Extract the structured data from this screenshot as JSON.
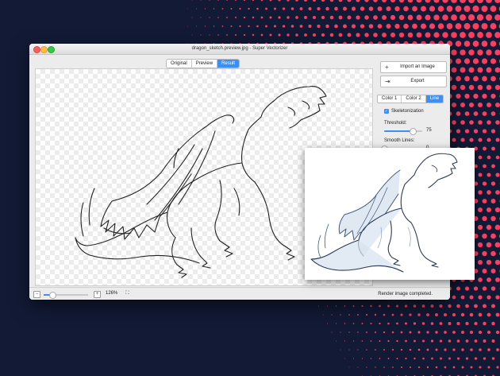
{
  "window": {
    "title": "dragon_sketch.preview.jpg - Super Vectorizer"
  },
  "view_tabs": [
    {
      "label": "Original",
      "active": false
    },
    {
      "label": "Preview",
      "active": false
    },
    {
      "label": "Result",
      "active": true
    }
  ],
  "panel": {
    "import_label": "Import an Image",
    "export_label": "Export",
    "color_tabs": [
      {
        "label": "Color 1",
        "active": false
      },
      {
        "label": "Color 2",
        "active": false
      },
      {
        "label": "Line",
        "active": true
      }
    ],
    "skeletonization_label": "Skeletonization",
    "skeletonization_checked": true,
    "threshold_label": "Threshold:",
    "threshold_value": "75",
    "threshold_level": 0.75,
    "smooth_label": "Smooth Lines:",
    "smooth_value": "0",
    "smooth_level": 0.0
  },
  "bottom": {
    "zoom_label": "126%",
    "zoom_level": 0.2,
    "status": "Render image completed."
  },
  "colors": {
    "accent": "#3b8ff6",
    "background": "#121a36",
    "dots": "#ff3d5f"
  },
  "icons": {
    "import": "plus-icon",
    "export": "export-icon",
    "zoom_out": "minus-icon",
    "zoom_in": "plus-icon",
    "fit": "fullscreen-icon"
  }
}
